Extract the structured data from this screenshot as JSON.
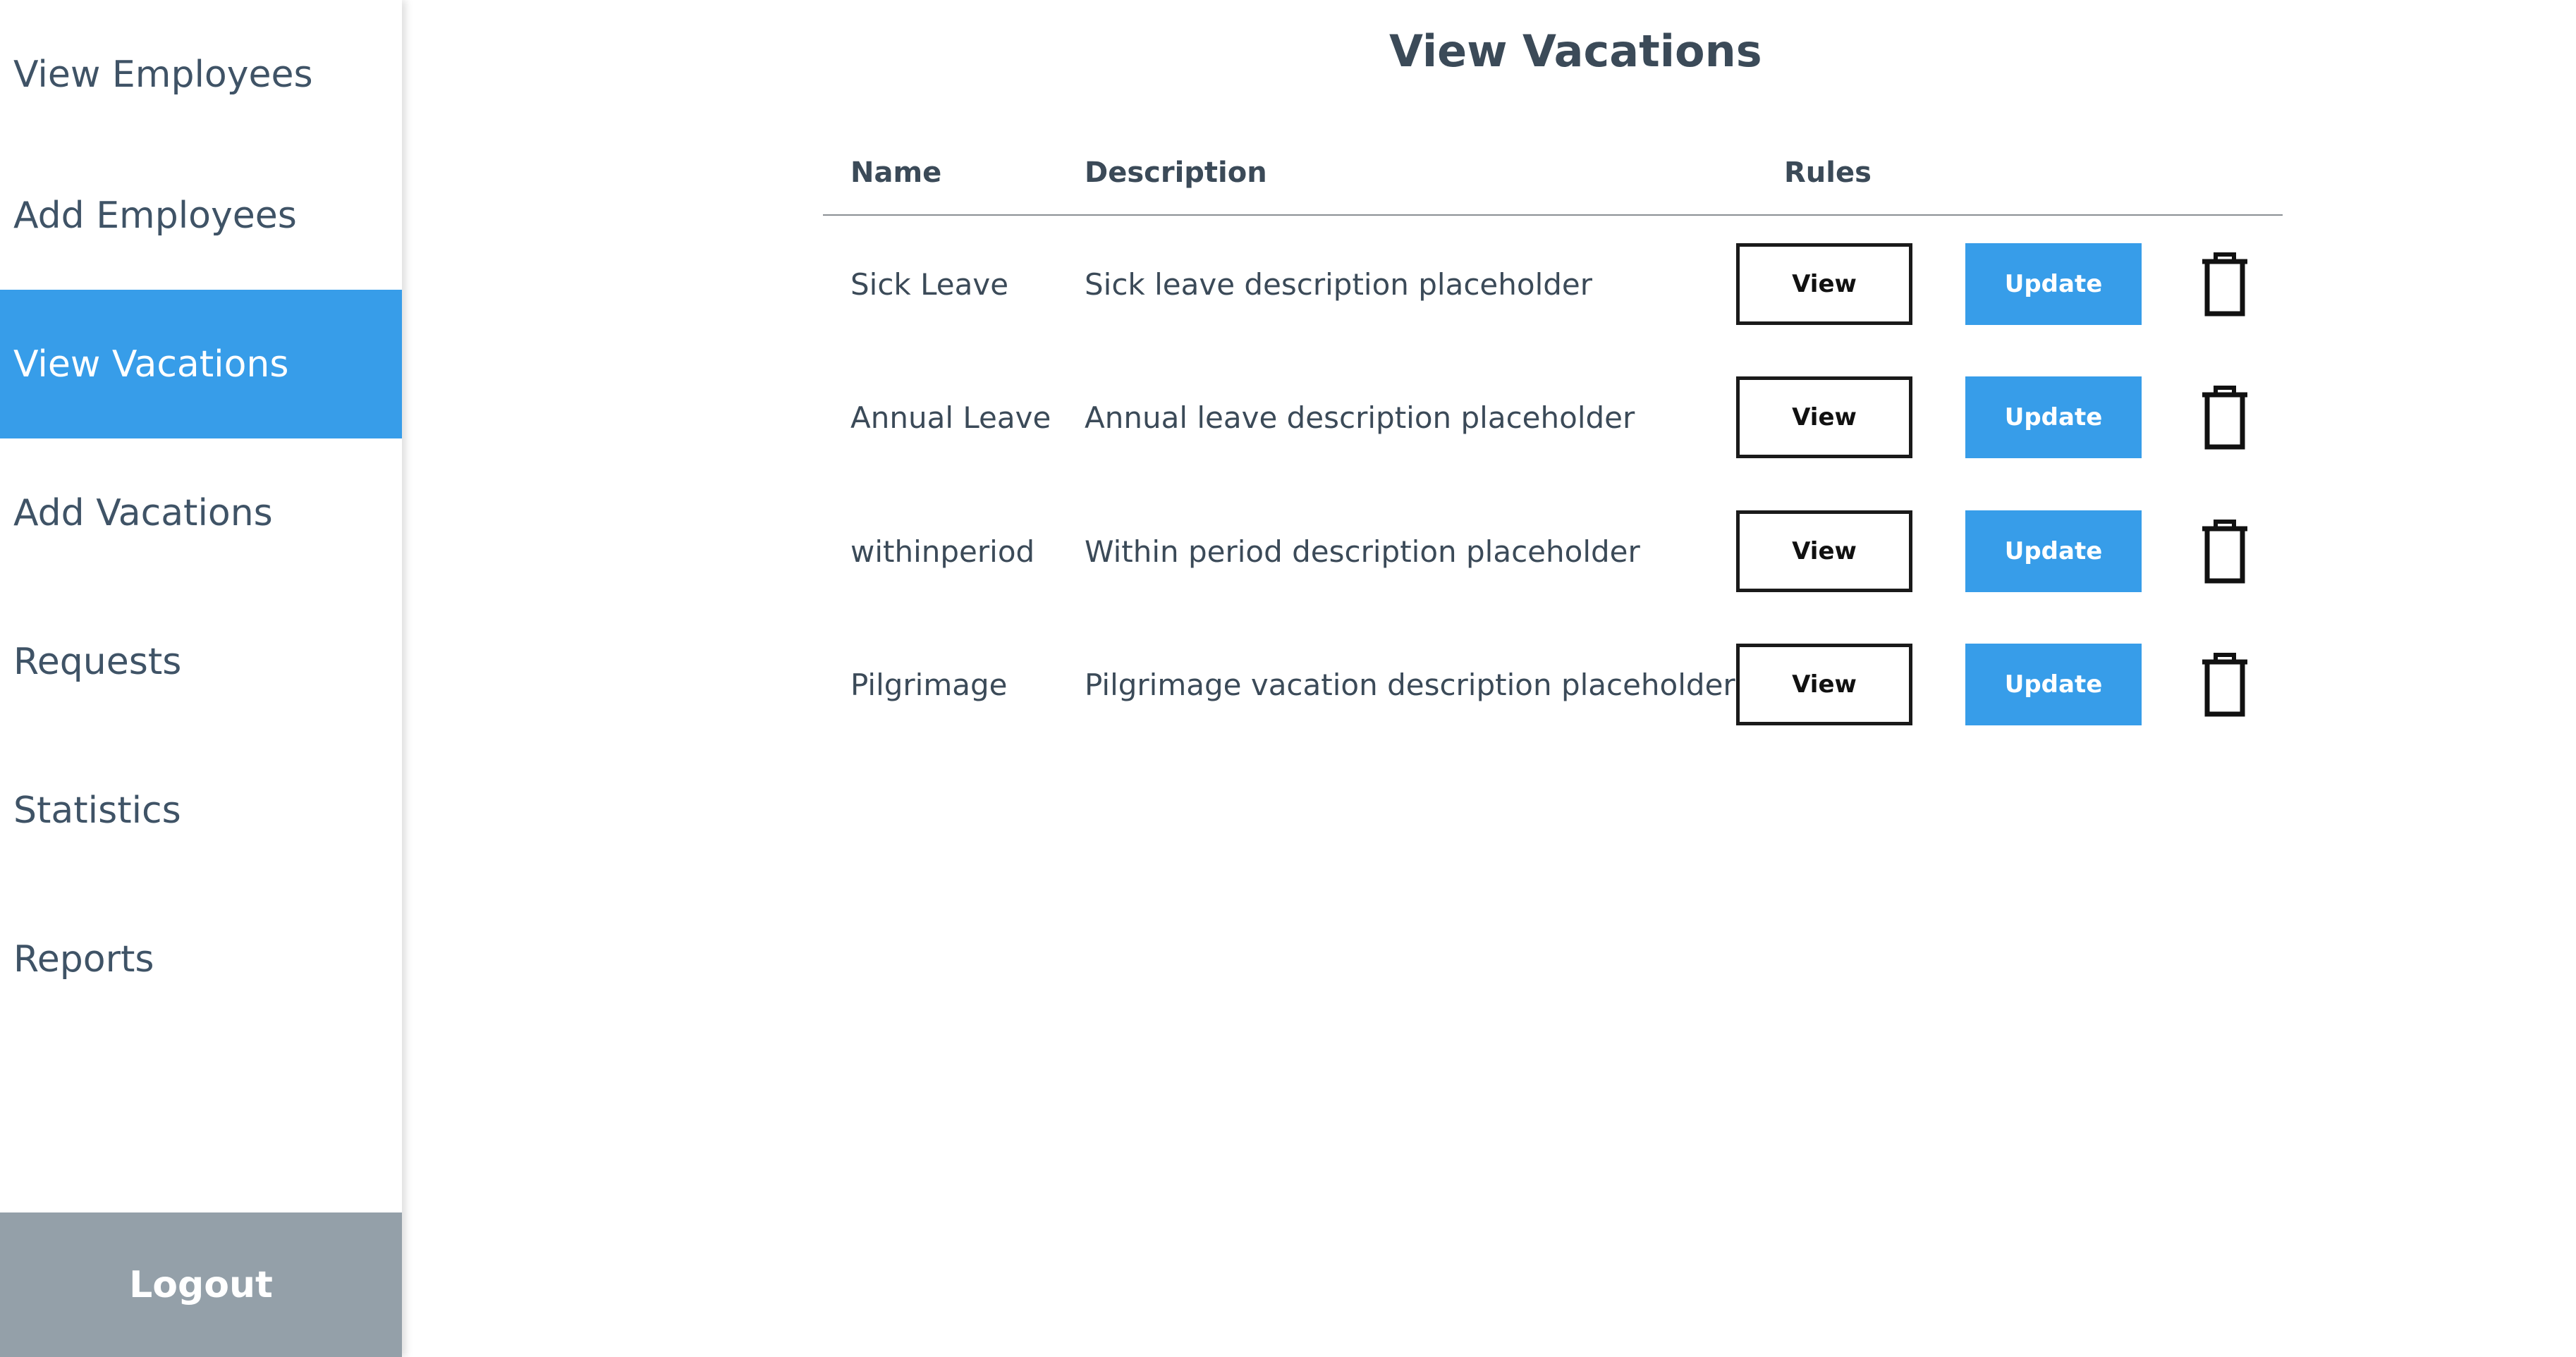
{
  "sidebar": {
    "items": [
      {
        "label": "View Employees"
      },
      {
        "label": "Add Employees"
      },
      {
        "label": "View Vacations"
      },
      {
        "label": "Add Vacations"
      },
      {
        "label": "Requests"
      },
      {
        "label": "Statistics"
      },
      {
        "label": "Reports"
      }
    ],
    "active_item": "View Vacations",
    "logout_label": "Logout"
  },
  "main": {
    "title": "View Vacations",
    "table": {
      "headers": {
        "name": "Name",
        "description": "Description",
        "rules": "Rules"
      },
      "rows": [
        {
          "name": "Sick Leave",
          "description": "Sick leave description placeholder",
          "view_label": "View",
          "update_label": "Update"
        },
        {
          "name": "Annual Leave",
          "description": "Annual leave description placeholder",
          "view_label": "View",
          "update_label": "Update"
        },
        {
          "name": "withinperiod",
          "description": "Within period description placeholder",
          "view_label": "View",
          "update_label": "Update"
        },
        {
          "name": "Pilgrimage",
          "description": "Pilgrimage vacation description placeholder",
          "view_label": "View",
          "update_label": "Update"
        }
      ],
      "row_action_icon": "trash-icon"
    }
  },
  "colors": {
    "accent": "#379de9",
    "logout_bg": "#94a0a9",
    "text": "#3b4a58"
  }
}
